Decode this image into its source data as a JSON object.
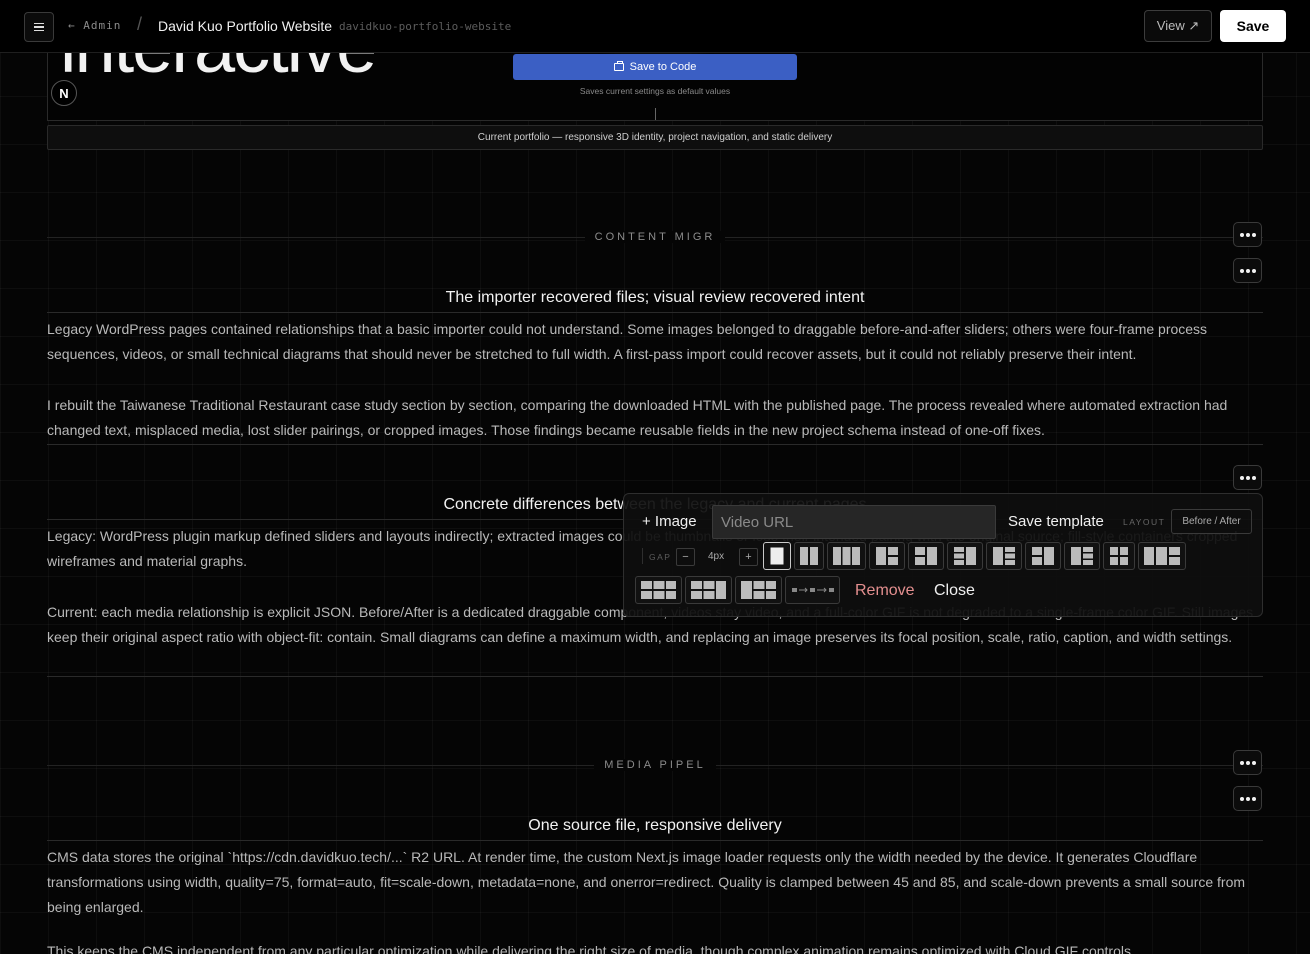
{
  "header": {
    "menu_label": "Menu",
    "back_label": "← Admin",
    "separator": "/",
    "title": "David Kuo Portfolio Website",
    "slug": "davidkuo-portfolio-website",
    "view_label": "View ↗",
    "save_label": "Save"
  },
  "hero": {
    "word": "interactive",
    "badge": "N",
    "save_to_code_label": "Save to Code",
    "save_hint": "Saves current settings as default values",
    "caption": "Current portfolio — responsive 3D identity, project navigation, and static delivery"
  },
  "sections": [
    {
      "label": "CONTENT MIGR",
      "heading": "The importer recovered files; visual review recovered intent",
      "paragraphs": [
        "Legacy WordPress pages contained relationships that a basic importer could not understand. Some images belonged to draggable before-and-after sliders; others were four-frame process sequences, videos, or small technical diagrams that should never be stretched to full width. A first-pass import could recover assets, but it could not reliably preserve their intent.",
        "I rebuilt the Taiwanese Traditional Restaurant case study section by section, comparing the downloaded HTML with the published page. The process revealed where automated extraction had changed text, misplaced media, lost slider pairings, or cropped images. Those findings became reusable fields in the new project schema instead of one-off fixes."
      ]
    },
    {
      "heading": "Concrete differences between the legacy and current pages",
      "paragraphs": [
        "Legacy: WordPress plugin markup defined sliders and layouts indirectly; extracted images could be thumbnails or lose their intended pairing with the original source; fill-style containers cropped wireframes and material graphs.",
        "Current: each media relationship is explicit JSON. Before/After is a dedicated draggable component, videos stay video, and a full-color GIF is not degraded to a single-frame color GIF. Still images keep their original aspect ratio with object-fit: contain. Small diagrams can define a maximum width, and replacing an image preserves its focal position, scale, ratio, caption, and width settings."
      ]
    },
    {
      "label": "MEDIA PIPEL",
      "heading": "One source file, responsive delivery",
      "paragraphs": [
        "CMS data stores the original `https://cdn.davidkuo.tech/...` R2 URL. At render time, the custom Next.js image loader requests only the width needed by the device. It generates Cloudflare transformations using width, quality=75, format=auto, fit=scale-down, metadata=none, and onerror=redirect. Quality is clamped between 45 and 85, and scale-down prevents a small source from being enlarged.",
        "This keeps the CMS independent from any particular optimization while delivering the right size of media, though complex animation remains optimized with Cloud GIF controls."
      ]
    }
  ],
  "popover": {
    "add_image_label": "+ Image",
    "video_placeholder": "Video URL",
    "save_template_label": "Save template",
    "layout_label": "LAYOUT",
    "before_after_label": "Before / After",
    "gap_label": "GAP",
    "gap_minus": "−",
    "gap_value": "4px",
    "gap_plus": "+",
    "remove_label": "Remove",
    "close_label": "Close"
  },
  "colors": {
    "background": "#050505",
    "accent_blue": "#3b5fc4",
    "remove_red": "#e38f8f",
    "save_button_bg": "#ffffff"
  }
}
